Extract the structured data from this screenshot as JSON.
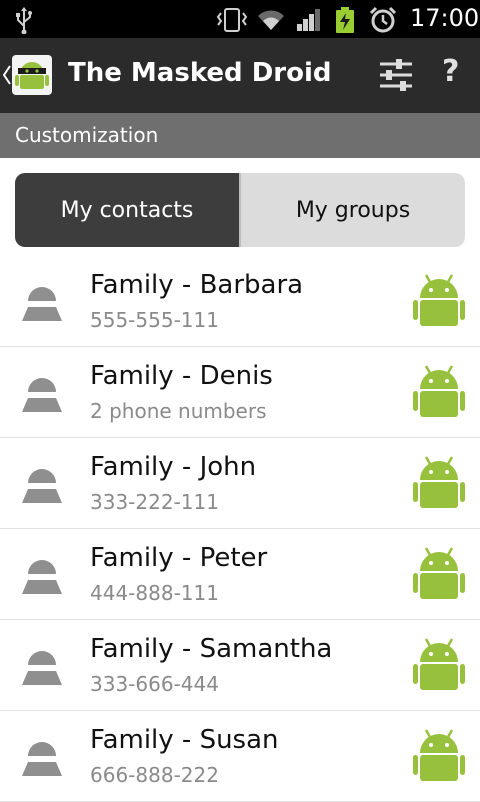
{
  "status": {
    "time": "17:00"
  },
  "app": {
    "title": "The Masked Droid"
  },
  "subheader": {
    "label": "Customization"
  },
  "tabs": [
    {
      "label": "My contacts",
      "active": true
    },
    {
      "label": "My groups",
      "active": false
    }
  ],
  "contacts": [
    {
      "name": "Family - Barbara",
      "detail": "555-555-111"
    },
    {
      "name": "Family - Denis",
      "detail": "2 phone numbers"
    },
    {
      "name": "Family - John",
      "detail": "333-222-111"
    },
    {
      "name": "Family - Peter",
      "detail": "444-888-111"
    },
    {
      "name": "Family - Samantha",
      "detail": "333-666-444"
    },
    {
      "name": "Family - Susan",
      "detail": "666-888-222"
    }
  ],
  "colors": {
    "actionbar": "#2b2b2b",
    "subheader": "#6f6f6f",
    "tab_active": "#3d3d3d",
    "tab_inactive": "#dcdcdc",
    "android_green": "#97c03d"
  },
  "icons": [
    "usb-icon",
    "vibrate-icon",
    "wifi-icon",
    "signal-icon",
    "battery-charging-icon",
    "alarm-icon",
    "back-caret-icon",
    "app-logo-icon",
    "settings-sliders-icon",
    "help-icon",
    "contact-avatar-icon",
    "android-droid-icon"
  ]
}
